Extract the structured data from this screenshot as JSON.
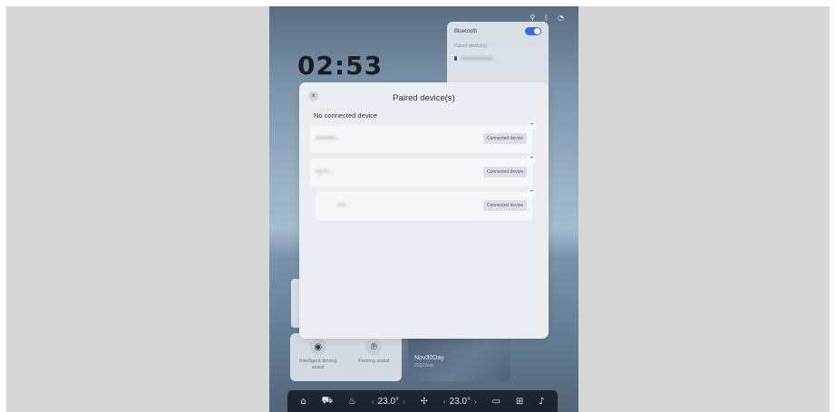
{
  "status_bar": {
    "icons": [
      "link-icon",
      "bluetooth-icon",
      "wifi-icon"
    ]
  },
  "home": {
    "time": "02:53",
    "bluetooth_panel": {
      "title": "Bluetooth",
      "toggle_on": true,
      "section_label": "Paired device(s)"
    },
    "quick_controls": [
      {
        "label": "Intelligent driving assist",
        "icon": "steering-icon"
      },
      {
        "label": "Parking assist",
        "icon": "parking-icon"
      }
    ],
    "date_card": {
      "main": "Nov30Day",
      "sub": "2022Year"
    },
    "bottom_bar": {
      "temp_left": "23.0°",
      "temp_right": "23.0°"
    }
  },
  "modal": {
    "title": "Paired device(s)",
    "close_icon": "close-icon",
    "section_label": "No connected device",
    "devices": [
      {
        "name": "vivoX80...",
        "badge": "Connected device"
      },
      {
        "name": "iQOO...",
        "badge": "Connected device"
      },
      {
        "name": "iPh...",
        "badge": "Connected device"
      }
    ]
  }
}
